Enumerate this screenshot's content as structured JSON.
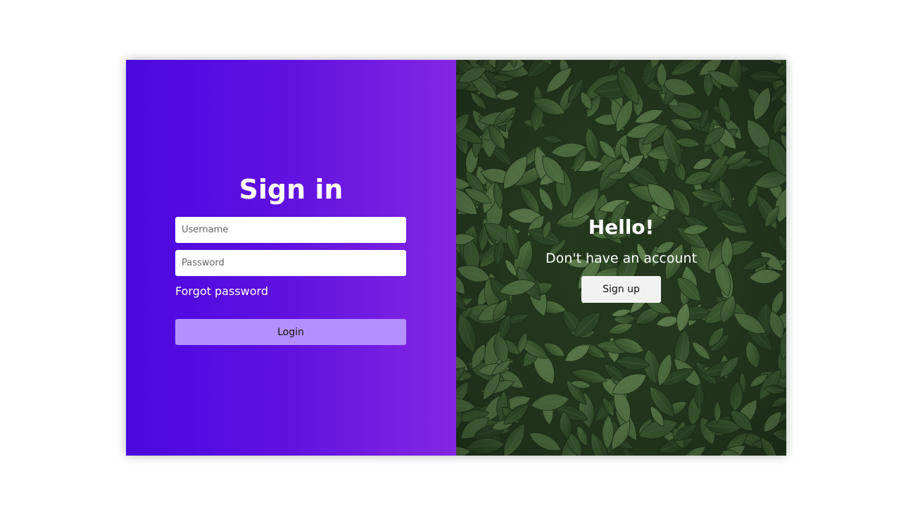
{
  "signin": {
    "title": "Sign in",
    "username_placeholder": "Username",
    "password_placeholder": "Password",
    "forgot_label": "Forgot password",
    "login_label": "Login"
  },
  "welcome": {
    "title": "Hello!",
    "subtitle": "Don't have an account",
    "signup_label": "Sign up"
  },
  "colors": {
    "gradient_start": "#4a08df",
    "gradient_end": "#8426e2",
    "login_button": "#b390fd",
    "signup_button": "#f2f2f2",
    "leaf_background": "#2d4424"
  }
}
